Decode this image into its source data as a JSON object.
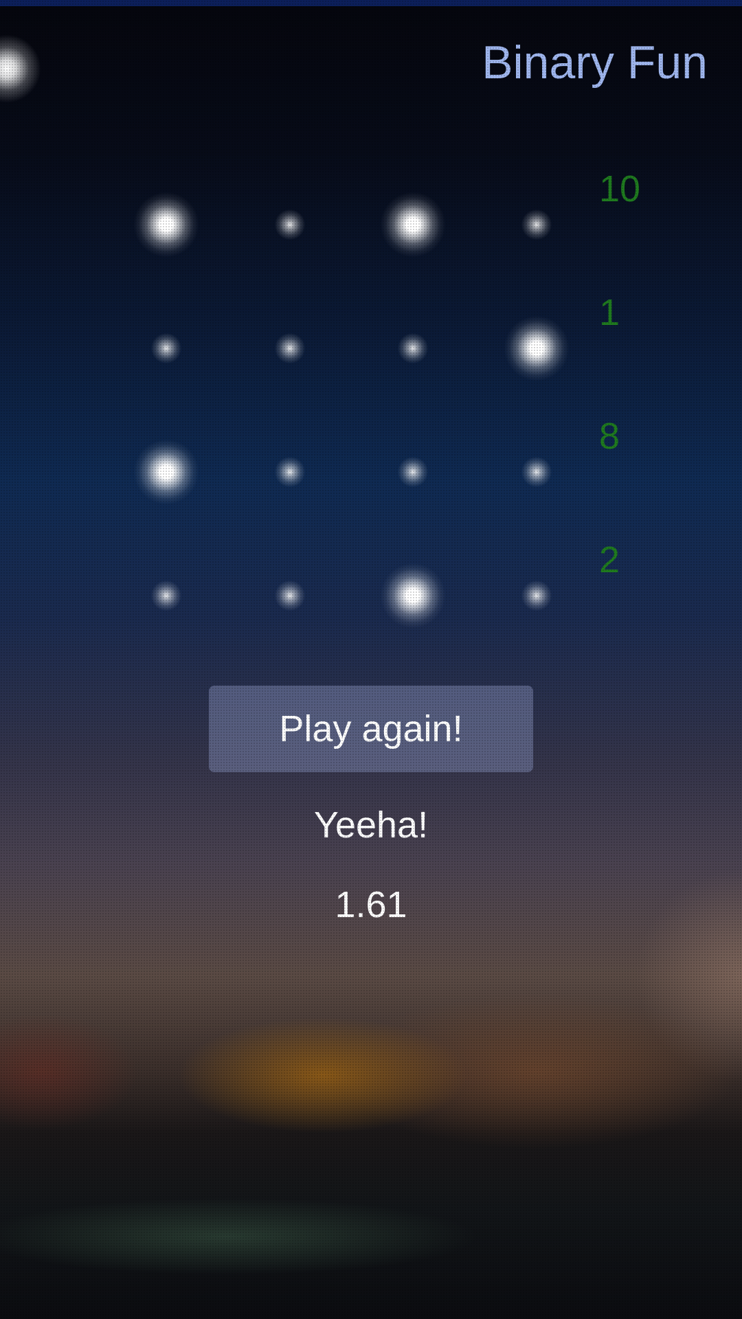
{
  "app": {
    "title": "Binary Fun"
  },
  "game": {
    "rows": [
      {
        "bits": [
          true,
          false,
          true,
          false
        ],
        "value": "10"
      },
      {
        "bits": [
          false,
          false,
          false,
          true
        ],
        "value": "1"
      },
      {
        "bits": [
          true,
          false,
          false,
          false
        ],
        "value": "8"
      },
      {
        "bits": [
          false,
          false,
          true,
          false
        ],
        "value": "2"
      }
    ],
    "play_again_label": "Play again!",
    "result": "Yeeha!",
    "score": "1.61"
  },
  "colors": {
    "title": "#9fb6ee",
    "row_value": "#1f7a1f",
    "button_bg": "rgba(120,130,170,0.55)"
  },
  "icons": {
    "led_on": "lit-led-icon",
    "led_off": "unlit-led-icon"
  }
}
